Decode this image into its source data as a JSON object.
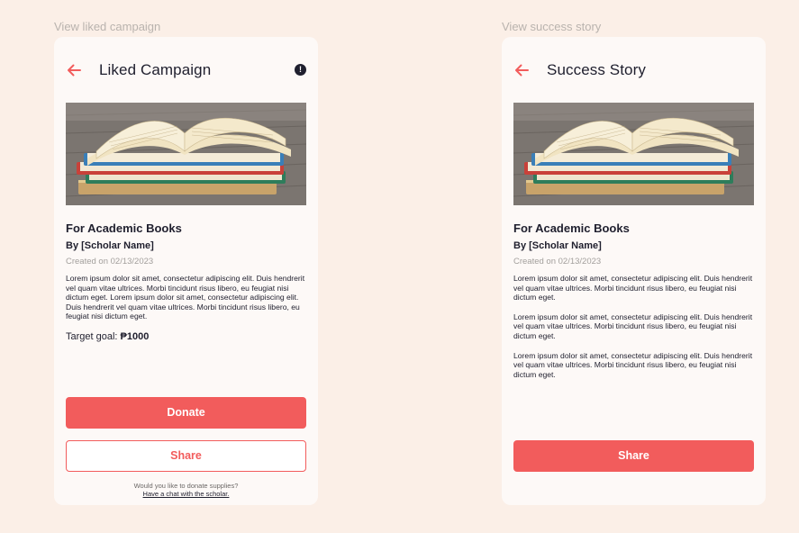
{
  "frames": [
    {
      "label": "View liked campaign",
      "header_title": "Liked Campaign",
      "info_icon": "!",
      "icon_names": {
        "back": "back-arrow-icon",
        "info": "info-icon"
      },
      "campaign_title": "For Academic Books",
      "byline": "By [Scholar Name]",
      "created": "Created on 02/13/2023",
      "paragraph": "Lorem ipsum dolor sit amet, consectetur adipiscing elit. Duis hendrerit vel quam vitae ultrices. Morbi tincidunt risus libero, eu feugiat nisi dictum eget. Lorem ipsum dolor sit amet, consectetur adipiscing elit. Duis hendrerit vel quam vitae ultrices. Morbi tincidunt risus libero, eu feugiat nisi dictum eget.",
      "goal_label": "Target goal: ",
      "goal_value": "₱1000",
      "donate_label": "Donate",
      "share_label": "Share",
      "footnote": "Would you like to donate supplies?",
      "footlink": "Have a chat with the scholar."
    },
    {
      "label": "View success story",
      "header_title": "Success Story",
      "icon_names": {
        "back": "back-arrow-icon"
      },
      "campaign_title": "For Academic Books",
      "byline": "By [Scholar Name]",
      "created": "Created on 02/13/2023",
      "paragraphs": [
        "Lorem ipsum dolor sit amet, consectetur adipiscing elit. Duis hendrerit vel quam vitae ultrices. Morbi tincidunt risus libero, eu feugiat nisi dictum eget.",
        "Lorem ipsum dolor sit amet, consectetur adipiscing elit. Duis hendrerit vel quam vitae ultrices. Morbi tincidunt risus libero, eu feugiat nisi dictum eget.",
        "Lorem ipsum dolor sit amet, consectetur adipiscing elit. Duis hendrerit vel quam vitae ultrices. Morbi tincidunt risus libero, eu feugiat nisi dictum eget."
      ],
      "share_label": "Share"
    }
  ],
  "colors": {
    "page_bg": "#fbefe7",
    "card_bg": "#fdf9f7",
    "accent": "#f25c5c",
    "text": "#1f1f2e",
    "muted": "#a29f9c"
  }
}
